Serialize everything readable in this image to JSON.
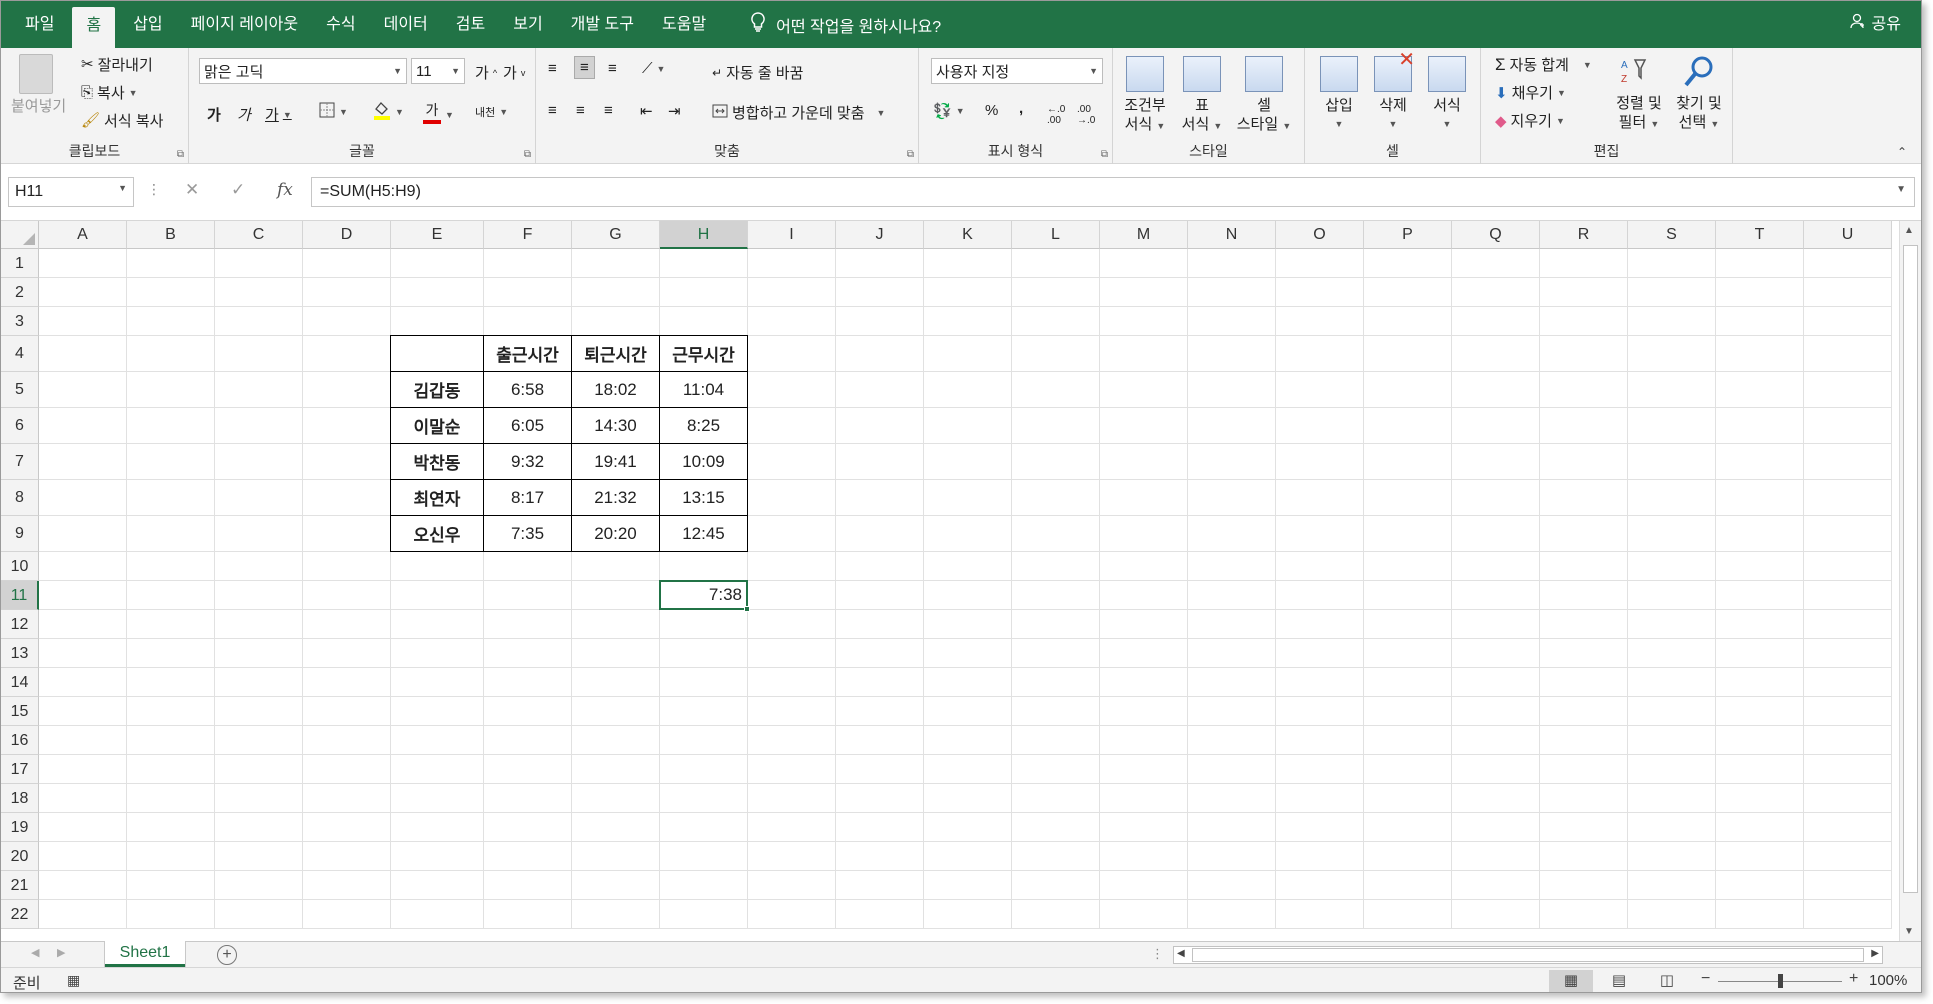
{
  "tabs": [
    "파일",
    "홈",
    "삽입",
    "페이지 레이아웃",
    "수식",
    "데이터",
    "검토",
    "보기",
    "개발 도구",
    "도움말"
  ],
  "tell_me": "어떤 작업을 원하시나요?",
  "share": "공유",
  "ribbon": {
    "clipboard": {
      "label": "클립보드",
      "paste": "붙여넣기",
      "cut": "잘라내기",
      "copy": "복사",
      "format_painter": "서식 복사"
    },
    "font": {
      "label": "글꼴",
      "font_name": "맑은 고딕",
      "font_size": "11",
      "grow": "가",
      "shrink": "가",
      "bold": "가",
      "italic": "가",
      "underline": "가",
      "color": "가",
      "phonetic": "내천"
    },
    "alignment": {
      "label": "맞춤",
      "wrap": "자동 줄 바꿈",
      "merge": "병합하고 가운데 맞춤"
    },
    "number": {
      "label": "표시 형식",
      "format": "사용자 지정",
      "percent": "%",
      "comma": ","
    },
    "styles": {
      "label": "스타일",
      "conditional": [
        "조건부",
        "서식"
      ],
      "table": [
        "표",
        "서식"
      ],
      "cell_styles": [
        "셀",
        "스타일"
      ]
    },
    "cells": {
      "label": "셀",
      "insert": "삽입",
      "delete": "삭제",
      "format": "서식"
    },
    "editing": {
      "label": "편집",
      "autosum": "자동 합계",
      "fill": "채우기",
      "clear": "지우기",
      "sort": [
        "정렬 및",
        "필터"
      ],
      "find": [
        "찾기 및",
        "선택"
      ]
    }
  },
  "formula_bar": {
    "name_box": "H11",
    "formula": "=SUM(H5:H9)",
    "fx": "fx"
  },
  "columns": [
    "A",
    "B",
    "C",
    "D",
    "E",
    "F",
    "G",
    "H",
    "I",
    "J",
    "K",
    "L",
    "M",
    "N",
    "O",
    "P",
    "Q",
    "R",
    "S",
    "T",
    "U"
  ],
  "rows": [
    "1",
    "2",
    "3",
    "4",
    "5",
    "6",
    "7",
    "8",
    "9",
    "10",
    "11",
    "12",
    "13",
    "14",
    "15",
    "16",
    "17",
    "18",
    "19",
    "20",
    "21",
    "22"
  ],
  "table": {
    "headers": [
      "",
      "출근시간",
      "퇴근시간",
      "근무시간"
    ],
    "rows": [
      [
        "김갑동",
        "6:58",
        "18:02",
        "11:04"
      ],
      [
        "이말순",
        "6:05",
        "14:30",
        "8:25"
      ],
      [
        "박찬동",
        "9:32",
        "19:41",
        "10:09"
      ],
      [
        "최연자",
        "8:17",
        "21:32",
        "13:15"
      ],
      [
        "오신우",
        "7:35",
        "20:20",
        "12:45"
      ]
    ]
  },
  "selected_cell_value": "7:38",
  "sheet_tab": "Sheet1",
  "status": {
    "ready": "준비",
    "zoom": "100%"
  },
  "colors": {
    "accent": "#217346"
  }
}
